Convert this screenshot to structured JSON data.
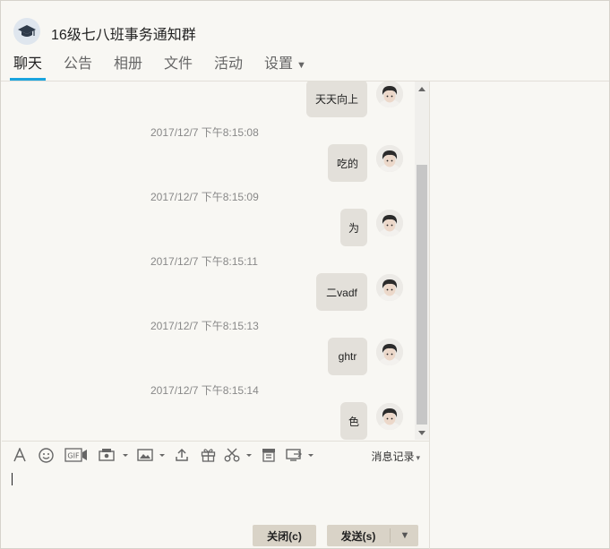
{
  "header": {
    "group_title": "16级七八班事务通知群",
    "group_avatar_icon": "graduation-cap-icon",
    "tabs": [
      {
        "label": "聊天",
        "active": true
      },
      {
        "label": "公告",
        "active": false
      },
      {
        "label": "相册",
        "active": false
      },
      {
        "label": "文件",
        "active": false
      },
      {
        "label": "活动",
        "active": false
      },
      {
        "label": "设置",
        "active": false,
        "caret": "▼"
      }
    ]
  },
  "messages": [
    {
      "timestamp": "",
      "text": "天天向上"
    },
    {
      "timestamp": "2017/12/7 下午8:15:08",
      "text": "吃的"
    },
    {
      "timestamp": "2017/12/7 下午8:15:09",
      "text": "为"
    },
    {
      "timestamp": "2017/12/7 下午8:15:11",
      "text": "二vadf"
    },
    {
      "timestamp": "2017/12/7 下午8:15:13",
      "text": "ghtr"
    },
    {
      "timestamp": "2017/12/7 下午8:15:14",
      "text": "色"
    }
  ],
  "toolbar": {
    "icons": [
      "font-icon",
      "emoji-icon",
      "gif-icon",
      "image-send-icon",
      "picture-icon",
      "upload-icon",
      "gift-icon",
      "scissors-icon",
      "archive-icon",
      "screen-share-icon"
    ],
    "history_label": "消息记录",
    "history_caret": "▾"
  },
  "input": {
    "value": ""
  },
  "buttons": {
    "close_label": "关闭(c)",
    "send_label": "发送(s)",
    "send_dropdown": "▼"
  },
  "colors": {
    "accent": "#1aa4de",
    "background": "#f8f7f3",
    "bubble": "#e3e0da",
    "button": "#d9d3c7"
  }
}
